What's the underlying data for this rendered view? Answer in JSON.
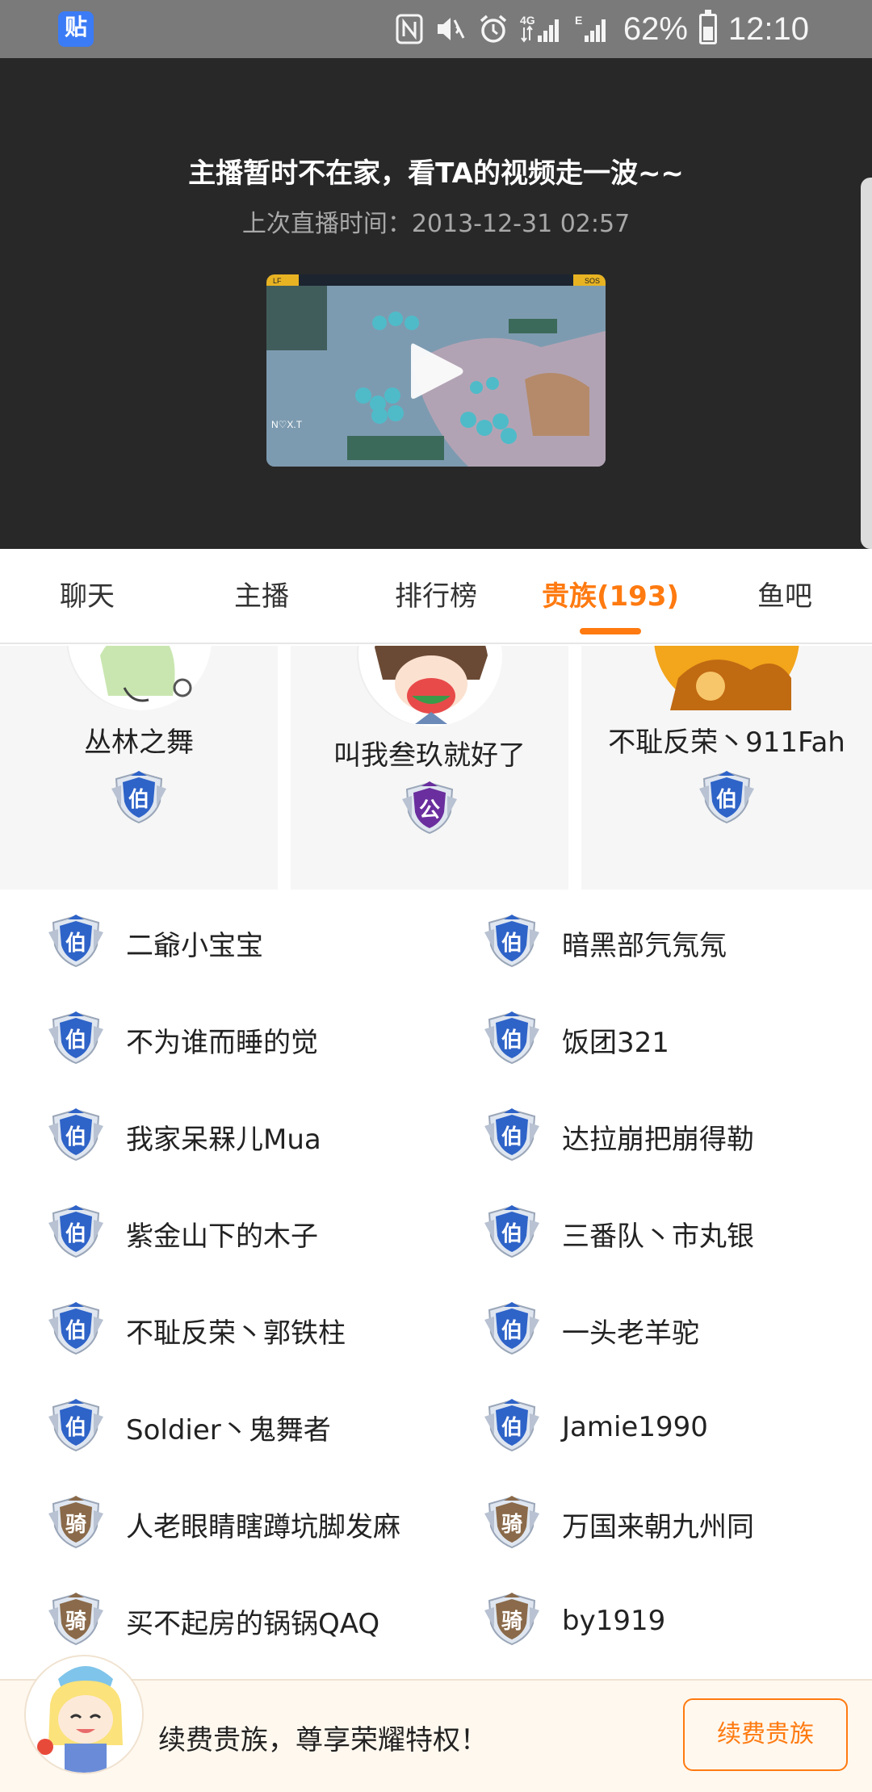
{
  "status_bar": {
    "app_badge": "贴",
    "network": "4G",
    "battery": "62%",
    "battery_level": 0.62,
    "time": "12:10"
  },
  "video": {
    "offline_title": "主播暂时不在家，看TA的视频走一波~~",
    "last_live": "上次直播时间：2013-12-31  02:57",
    "thumb_labels": {
      "left": "LF",
      "right": "SOS",
      "logo": "N♡X.T"
    }
  },
  "tabs": [
    {
      "label": "聊天",
      "active": false
    },
    {
      "label": "主播",
      "active": false
    },
    {
      "label": "排行榜",
      "active": false
    },
    {
      "label": "贵族(193)",
      "active": true
    },
    {
      "label": "鱼吧",
      "active": false
    }
  ],
  "top_nobles": [
    {
      "name": "丛林之舞",
      "badge": "伯"
    },
    {
      "name": "叫我叁玖就好了",
      "badge": "公"
    },
    {
      "name": "不耻反荣丶911Fah",
      "badge": "伯"
    }
  ],
  "nobles": [
    {
      "name": "二爺小宝宝",
      "badge": "伯"
    },
    {
      "name": "暗黑部氕氖氖",
      "badge": "伯"
    },
    {
      "name": "不为谁而睡的觉",
      "badge": "伯"
    },
    {
      "name": "饭团321",
      "badge": "伯"
    },
    {
      "name": "我家呆槑儿Mua",
      "badge": "伯"
    },
    {
      "name": "达拉崩把崩得勒",
      "badge": "伯"
    },
    {
      "name": "紫金山下的木子",
      "badge": "伯"
    },
    {
      "name": "三番队丶市丸银",
      "badge": "伯"
    },
    {
      "name": "不耻反荣丶郭铁柱",
      "badge": "伯"
    },
    {
      "name": "一头老羊驼",
      "badge": "伯"
    },
    {
      "name": "Soldier丶鬼舞者",
      "badge": "伯"
    },
    {
      "name": "Jamie1990",
      "badge": "伯"
    },
    {
      "name": "人老眼睛瞎蹲坑脚发麻",
      "badge": "骑"
    },
    {
      "name": "万国来朝九州同",
      "badge": "骑"
    },
    {
      "name": "买不起房的锅锅QAQ",
      "badge": "骑"
    },
    {
      "name": "by1919",
      "badge": "骑"
    }
  ],
  "bottom_bar": {
    "promo": "续费贵族，尊享荣耀特权！",
    "button": "续费贵族"
  },
  "colors": {
    "accent": "#ff7a10",
    "header_bg": "#282828",
    "badge_blue": "#2e63c8",
    "badge_purple": "#6a2e9e",
    "badge_bronze": "#8a6a4a"
  }
}
